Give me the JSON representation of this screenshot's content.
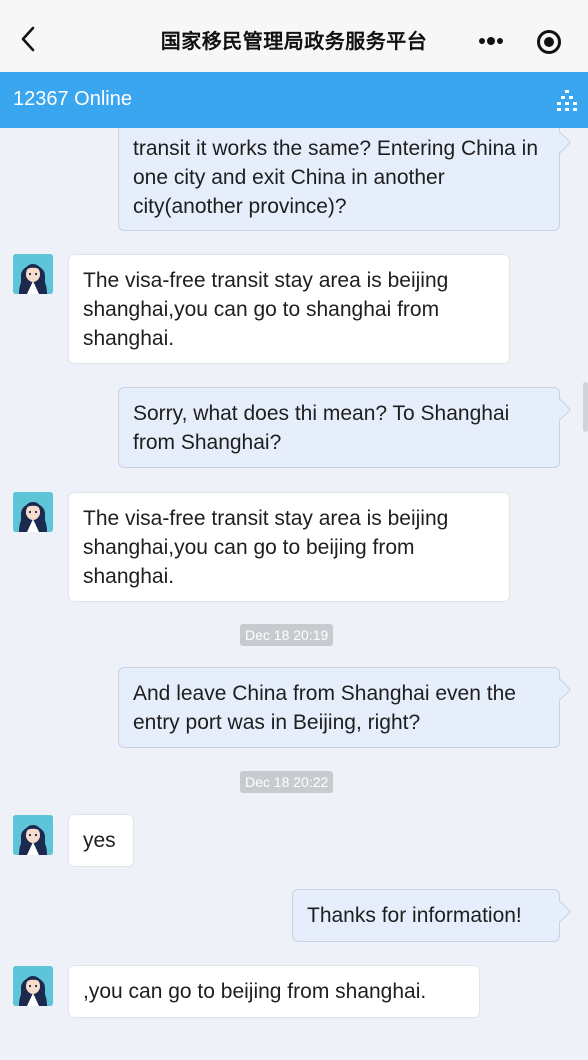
{
  "topbar": {
    "title": "国家移民管理局政务服务平台",
    "back_icon": "chevron-left-icon",
    "more_icon": "more-dots-icon",
    "target_icon": "target-icon"
  },
  "service": {
    "title": "12367 Online",
    "menu_icon": "menu-icon",
    "color": "#3aa6ef"
  },
  "messages": [
    {
      "sender": "user",
      "text": "transit it works the same? Entering China in one city and exit China in another city(another province)?"
    },
    {
      "sender": "bot",
      "text": "The visa-free transit stay area is beijing shanghai,you can go to  shanghai from shanghai."
    },
    {
      "sender": "user",
      "text": "Sorry, what does thi mean? To Shanghai from Shanghai?"
    },
    {
      "sender": "bot",
      "text": "The visa-free transit stay area is beijing shanghai,you can go to beijing from shanghai."
    },
    {
      "sender": "time",
      "text": "Dec 18 20:19"
    },
    {
      "sender": "user",
      "text": "And leave China from Shanghai even the entry port was in Beijing, right?"
    },
    {
      "sender": "time",
      "text": "Dec 18 20:22"
    },
    {
      "sender": "bot",
      "text": "yes"
    },
    {
      "sender": "user",
      "text": "Thanks for information!"
    },
    {
      "sender": "bot",
      "text": ",you can go to beijing from shanghai."
    }
  ],
  "colors": {
    "user_bubble": "#e6edfb",
    "bot_bubble": "#ffffff",
    "background": "#eef1f7"
  }
}
